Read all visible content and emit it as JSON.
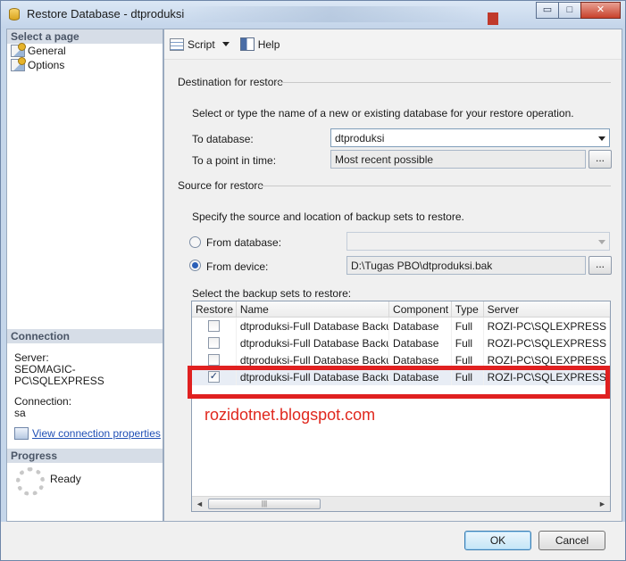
{
  "window": {
    "title": "Restore Database - dtproduksi",
    "minimize_glyph": "▭",
    "maximize_glyph": "□",
    "close_glyph": "✕"
  },
  "sidebar": {
    "select_page_header": "Select a page",
    "pages": [
      {
        "label": "General",
        "icon": "page-icon"
      },
      {
        "label": "Options",
        "icon": "page-icon"
      }
    ],
    "connection_header": "Connection",
    "server_label": "Server:",
    "server_value": "SEOMAGIC-PC\\SQLEXPRESS",
    "connection_label": "Connection:",
    "connection_value": "sa",
    "view_connection_link": "View connection properties",
    "progress_header": "Progress",
    "progress_status": "Ready"
  },
  "toolbar": {
    "script_label": "Script",
    "help_label": "Help"
  },
  "destination": {
    "group_title": "Destination for restore",
    "instruction": "Select or type the name of a new or existing database for your restore operation.",
    "to_database_label": "To database:",
    "to_database_value": "dtproduksi",
    "point_in_time_label": "To a point in time:",
    "point_in_time_value": "Most recent possible",
    "ellipsis": "..."
  },
  "source": {
    "group_title": "Source for restore",
    "instruction": "Specify the source and location of backup sets to restore.",
    "from_database_label": "From database:",
    "from_database_value": "",
    "from_device_label": "From device:",
    "from_device_value": "D:\\Tugas PBO\\dtproduksi.bak",
    "selected_option": "From device",
    "ellipsis": "...",
    "backup_sets_label": "Select the backup sets to restore:"
  },
  "backup_grid": {
    "columns": [
      "Restore",
      "Name",
      "Component",
      "Type",
      "Server"
    ],
    "rows": [
      {
        "restore": false,
        "name": "dtproduksi-Full Database Backup",
        "component": "Database",
        "type": "Full",
        "server": "ROZI-PC\\SQLEXPRESS"
      },
      {
        "restore": false,
        "name": "dtproduksi-Full Database Backup",
        "component": "Database",
        "type": "Full",
        "server": "ROZI-PC\\SQLEXPRESS"
      },
      {
        "restore": false,
        "name": "dtproduksi-Full Database Backup",
        "component": "Database",
        "type": "Full",
        "server": "ROZI-PC\\SQLEXPRESS"
      },
      {
        "restore": true,
        "name": "dtproduksi-Full Database Backup",
        "component": "Database",
        "type": "Full",
        "server": "ROZI-PC\\SQLEXPRESS"
      }
    ],
    "check_glyph": "✓",
    "scroll_left": "◄",
    "scroll_right": "►",
    "thumb_grip": "|||"
  },
  "watermark": "rozidotnet.blogspot.com",
  "footer": {
    "ok_label": "OK",
    "cancel_label": "Cancel"
  },
  "colors": {
    "highlight": "#e02020",
    "watermark": "#e0281e",
    "link": "#1f4fb5"
  }
}
